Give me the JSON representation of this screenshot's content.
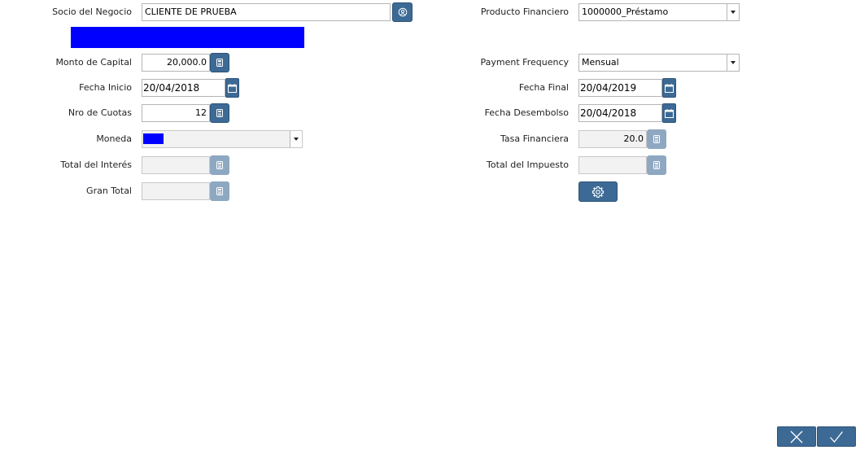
{
  "colors": {
    "accent": "#3d6a95",
    "accent_disabled": "#8ea8c2",
    "highlight": "#0000ff"
  },
  "left": {
    "socio": {
      "label": "Socio del Negocio",
      "value": "CLIENTE DE PRUEBA",
      "button_icon": "user-search-icon"
    },
    "monto": {
      "label": "Monto de Capital",
      "value": "20,000.0",
      "button_icon": "calculator-icon"
    },
    "fecha_inicio": {
      "label": "Fecha Inicio",
      "value": "20/04/2018",
      "button_icon": "calendar-icon"
    },
    "nro_cuotas": {
      "label": "Nro de Cuotas",
      "value": "12",
      "button_icon": "calculator-icon"
    },
    "moneda": {
      "label": "Moneda",
      "value": ""
    },
    "total_interes": {
      "label": "Total del Interés",
      "value": ""
    },
    "gran_total": {
      "label": "Gran Total",
      "value": ""
    }
  },
  "right": {
    "producto": {
      "label": "Producto Financiero",
      "value": "1000000_Préstamo"
    },
    "payment_frequency": {
      "label": "Payment Frequency",
      "value": "Mensual"
    },
    "fecha_final": {
      "label": "Fecha Final",
      "value": "20/04/2019",
      "button_icon": "calendar-icon"
    },
    "fecha_desembolso": {
      "label": "Fecha Desembolso",
      "value": "20/04/2018",
      "button_icon": "calendar-icon"
    },
    "tasa": {
      "label": "Tasa Financiera",
      "value": "20.0"
    },
    "total_impuesto": {
      "label": "Total del Impuesto",
      "value": ""
    },
    "settings_icon": "gear-icon"
  },
  "footer": {
    "cancel_icon": "close-icon",
    "ok_icon": "check-icon"
  }
}
